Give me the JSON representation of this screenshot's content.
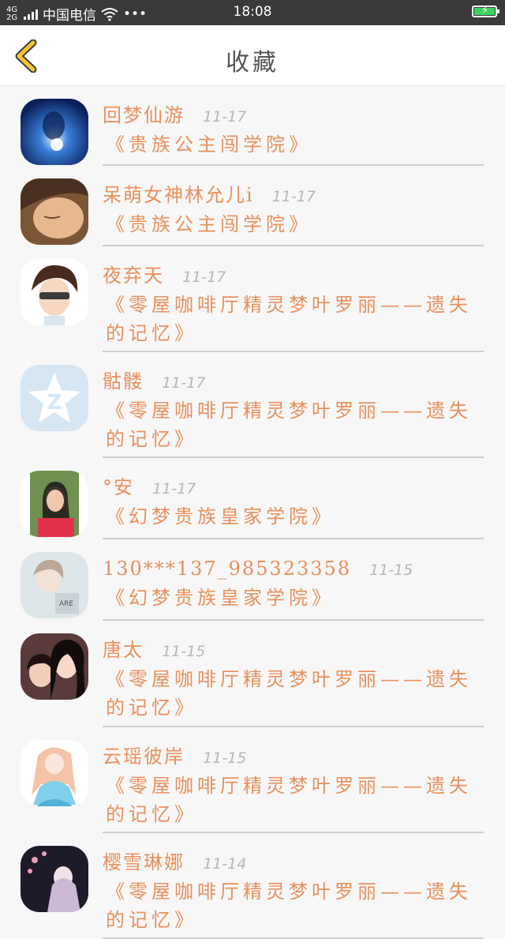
{
  "status_bar": {
    "signal": "4G 2G",
    "carrier": "中国电信",
    "more": "•••",
    "time": "18:08"
  },
  "header": {
    "title": "收藏"
  },
  "colors": {
    "accent": "#e8905d",
    "back_arrow": "#f4c531",
    "date": "#b7b7b7",
    "divider": "#cfcfcf"
  },
  "favorites": [
    {
      "name": "回梦仙游",
      "date": "11-17",
      "book": "《贵族公主闯学院》"
    },
    {
      "name": "呆萌女神林允儿i",
      "date": "11-17",
      "book": "《贵族公主闯学院》"
    },
    {
      "name": "夜弃天",
      "date": "11-17",
      "book": "《零屋咖啡厅精灵梦叶罗丽——遗失的记忆》"
    },
    {
      "name": "骷髅",
      "date": "11-17",
      "book": "《零屋咖啡厅精灵梦叶罗丽——遗失的记忆》"
    },
    {
      "name": "°安",
      "date": "11-17",
      "book": "《幻梦贵族皇家学院》"
    },
    {
      "name": "130***137_985323358",
      "date": "11-15",
      "book": "《幻梦贵族皇家学院》"
    },
    {
      "name": "唐太",
      "date": "11-15",
      "book": "《零屋咖啡厅精灵梦叶罗丽——遗失的记忆》"
    },
    {
      "name": "云瑶彼岸",
      "date": "11-15",
      "book": "《零屋咖啡厅精灵梦叶罗丽——遗失的记忆》"
    },
    {
      "name": "樱雪琳娜",
      "date": "11-14",
      "book": "《零屋咖啡厅精灵梦叶罗丽——遗失的记忆》"
    }
  ]
}
